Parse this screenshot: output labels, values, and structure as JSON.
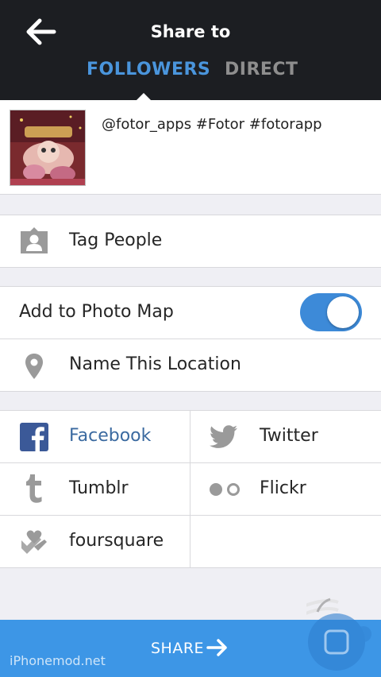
{
  "header": {
    "title": "Share to",
    "tabs": [
      "FOLLOWERS",
      "DIRECT"
    ],
    "active_tab": "FOLLOWERS"
  },
  "post": {
    "caption": "@fotor_apps #Fotor #fotorapp"
  },
  "options": {
    "tag_people": "Tag People",
    "add_to_photo_map": "Add to Photo Map",
    "photo_map_enabled": true,
    "name_location": "Name This Location"
  },
  "share_services": {
    "facebook": "Facebook",
    "twitter": "Twitter",
    "tumblr": "Tumblr",
    "flickr": "Flickr",
    "foursquare": "foursquare"
  },
  "footer": {
    "share_label": "SHARE",
    "watermark": "iPhonemod.net"
  },
  "colors": {
    "header_bg": "#1c1e22",
    "accent": "#4a95dc",
    "share_bar": "#3d96e6",
    "facebook": "#3b5998"
  }
}
